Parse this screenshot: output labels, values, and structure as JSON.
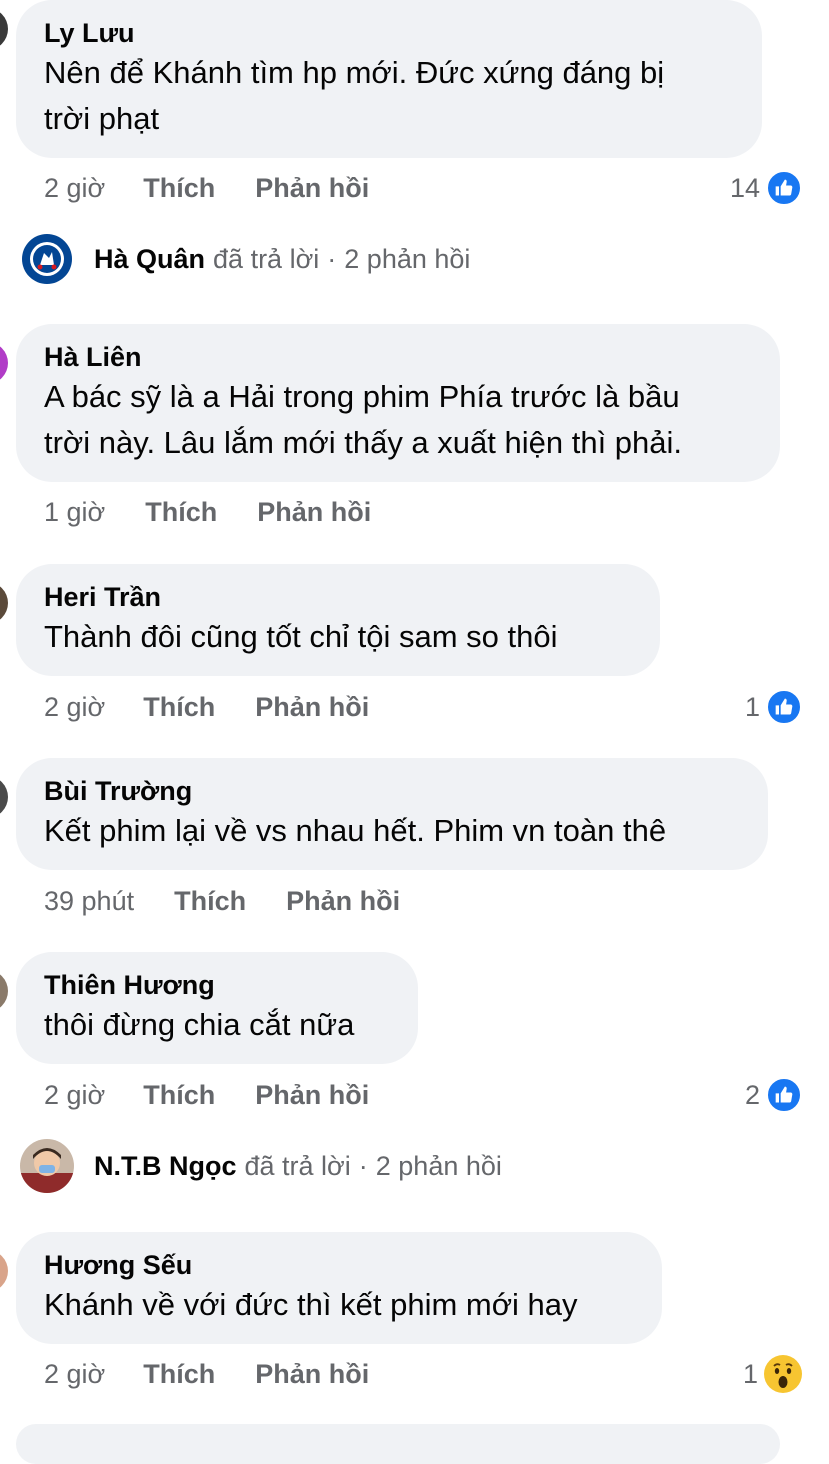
{
  "comments": [
    {
      "author": "Ly Lưu",
      "lines": [
        "Nên để Khánh tìm hp mới. Đức xứng đáng bị",
        "trời phạt"
      ],
      "time": "2 giờ",
      "like": "Thích",
      "reply": "Phản hồi",
      "reaction_count": "14",
      "reaction_type": "like-icon"
    },
    {
      "author": "Hà Liên",
      "lines": [
        "A bác sỹ là a Hải trong phim Phía trước là bầu",
        "trời này. Lâu lắm mới thấy a xuất hiện thì phải."
      ],
      "time": "1 giờ",
      "like": "Thích",
      "reply": "Phản hồi"
    },
    {
      "author": "Heri Trần",
      "lines": [
        "Thành đôi cũng tốt chỉ tội sam so thôi"
      ],
      "time": "2 giờ",
      "like": "Thích",
      "reply": "Phản hồi",
      "reaction_count": "1",
      "reaction_type": "like-icon"
    },
    {
      "author": "Bùi Trường",
      "lines": [
        "Kết phim lại về vs nhau hết. Phim vn toàn thê"
      ],
      "time": "39 phút",
      "like": "Thích",
      "reply": "Phản hồi"
    },
    {
      "author": "Thiên Hương",
      "lines": [
        "thôi đừng chia cắt nữa"
      ],
      "time": "2 giờ",
      "like": "Thích",
      "reply": "Phản hồi",
      "reaction_count": "2",
      "reaction_type": "like-icon"
    },
    {
      "author": "Hương Sếu",
      "lines": [
        "Khánh về với đức thì kết phim mới hay"
      ],
      "time": "2 giờ",
      "like": "Thích",
      "reply": "Phản hồi",
      "reaction_count": "1",
      "reaction_type": "wow-icon"
    }
  ],
  "reply_threads": [
    {
      "name": "Hà Quân",
      "action": "đã trả lời",
      "sep": "·",
      "count": "2 phản hồi",
      "avatar": "chelsea-crest-avatar"
    },
    {
      "name": "N.T.B Ngọc",
      "action": "đã trả lời",
      "sep": "·",
      "count": "2 phản hồi",
      "avatar": "child-photo-avatar"
    }
  ],
  "colors": {
    "bubble": "#f0f2f5",
    "secondary_text": "#65676b",
    "like_blue": "#1877f2",
    "wow_yellow": "#f7c531",
    "chelsea_blue": "#034694"
  }
}
